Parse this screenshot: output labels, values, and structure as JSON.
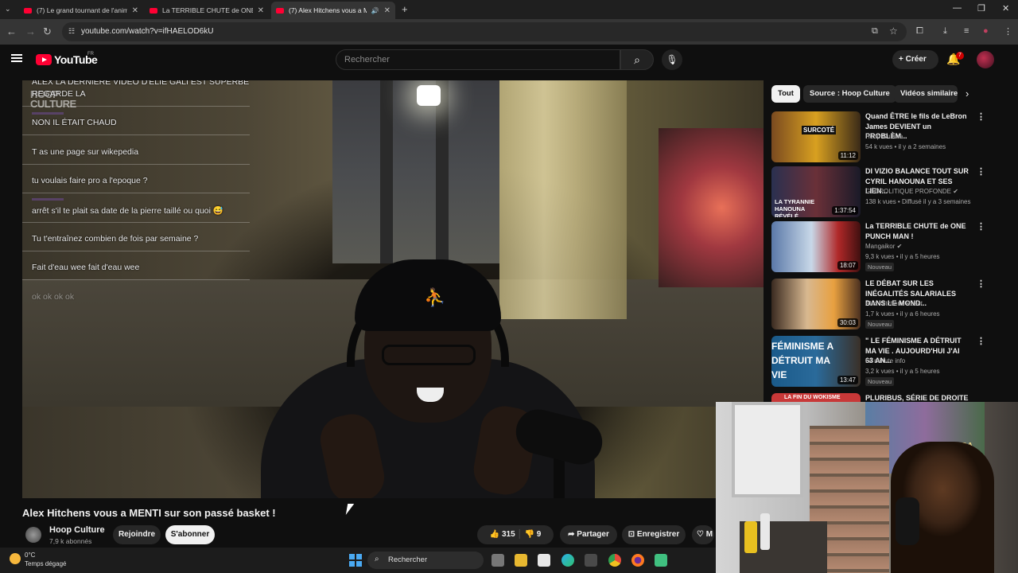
{
  "browser": {
    "tabs": [
      {
        "title": "(7) Le grand tournant de l'anim"
      },
      {
        "title": "La TERRIBLE CHUTE de ONE PU"
      },
      {
        "title": "(7) Alex Hitchens vous a M"
      }
    ],
    "url": "youtube.com/watch?v=ifHAELOD6kU"
  },
  "youtube": {
    "logo_text": "YouTube",
    "country": "FR",
    "search_placeholder": "Rechercher",
    "create_label": "Créer",
    "notifications": "7"
  },
  "video": {
    "chat_messages": [
      "ALEX LA DERNIERE VIDEO D'ELIE GALI EST SUPERBE",
      "REGARDE LA",
      "NON IL ÉTAIT CHAUD",
      "T as une page sur wikepedia",
      "tu voulais faire pro a l'epoque ?",
      "arrêt s'il te plait sa date de la pierre taillé ou quoi 😅",
      "Tu t'entraînez combien de fois par semaine ?",
      "Fait d'eau wee fait d'eau wee",
      "ok ok ok ok"
    ],
    "watermark": "HOOP CULTURE",
    "cap_logo": "⛹"
  },
  "details": {
    "title": "Alex Hitchens vous a MENTI sur son passé basket !",
    "channel": "Hoop Culture",
    "subscribers": "7,9 k abonnés",
    "join_label": "Rejoindre",
    "subscribe_label": "S'abonner",
    "likes": "315",
    "dislikes": "9",
    "share_label": "Partager",
    "save_label": "Enregistrer",
    "more_label": "M"
  },
  "filters": [
    "Tout",
    "Source : Hoop Culture",
    "Vidéos similaires"
  ],
  "recommendations": [
    {
      "title": "Quand ÊTRE le fils de LeBron James DEVIENT un PROBLÈM...",
      "channel": "Hoop Culture",
      "meta": "54 k vues • il y a 2 semaines",
      "duration": "11:12",
      "badge": "",
      "thumb_text": "SURCOTÉ"
    },
    {
      "title": "DI VIZIO BALANCE TOUT SUR CYRIL HANOUNA ET SES LIEN...",
      "channel": "GÉOPOLITIQUE PROFONDE",
      "meta": "138 k vues • Diffusé il y a 3 semaines",
      "duration": "1:37:54",
      "badge": "",
      "thumb_text": "LA TYRANNIE HANOUNA RÉVÉLÉ"
    },
    {
      "title": "La TERRIBLE CHUTE de ONE PUNCH MAN !",
      "channel": "Mangaikor",
      "meta": "9,3 k vues • il y a 5 heures",
      "duration": "18:07",
      "badge": "Nouveau",
      "thumb_text": ""
    },
    {
      "title": "LE DÉBAT SUR LES INÉGALITÉS SALARIALES DANS LE MOND...",
      "channel": "Alex Hitchens React",
      "meta": "1,7 k vues • il y a 6 heures",
      "duration": "30:03",
      "badge": "Nouveau",
      "thumb_text": ""
    },
    {
      "title": "\" LE FÉMINISME A DÉTRUIT MA VIE . AUJOURD'HUI J'AI 63 AN...",
      "channel": "La minute info",
      "meta": "3,2 k vues • il y a 5 heures",
      "duration": "13:47",
      "badge": "Nouveau",
      "thumb_text": "FÉMINISME A DÉTRUIT MA VIE"
    },
    {
      "title": "PLURIBUS, SÉRIE DE DROITE ?",
      "channel": "",
      "meta": "",
      "duration": "",
      "badge": "",
      "thumb_text": "LA FIN DU WOKISME"
    }
  ],
  "webcam": {
    "poster_text": "ZELDA"
  },
  "taskbar": {
    "temperature": "0°C",
    "weather": "Temps dégagé",
    "search_label": "Rechercher"
  },
  "colors": {
    "brand": "#ff0033",
    "background": "#0f0f0f",
    "chip": "#272727"
  }
}
